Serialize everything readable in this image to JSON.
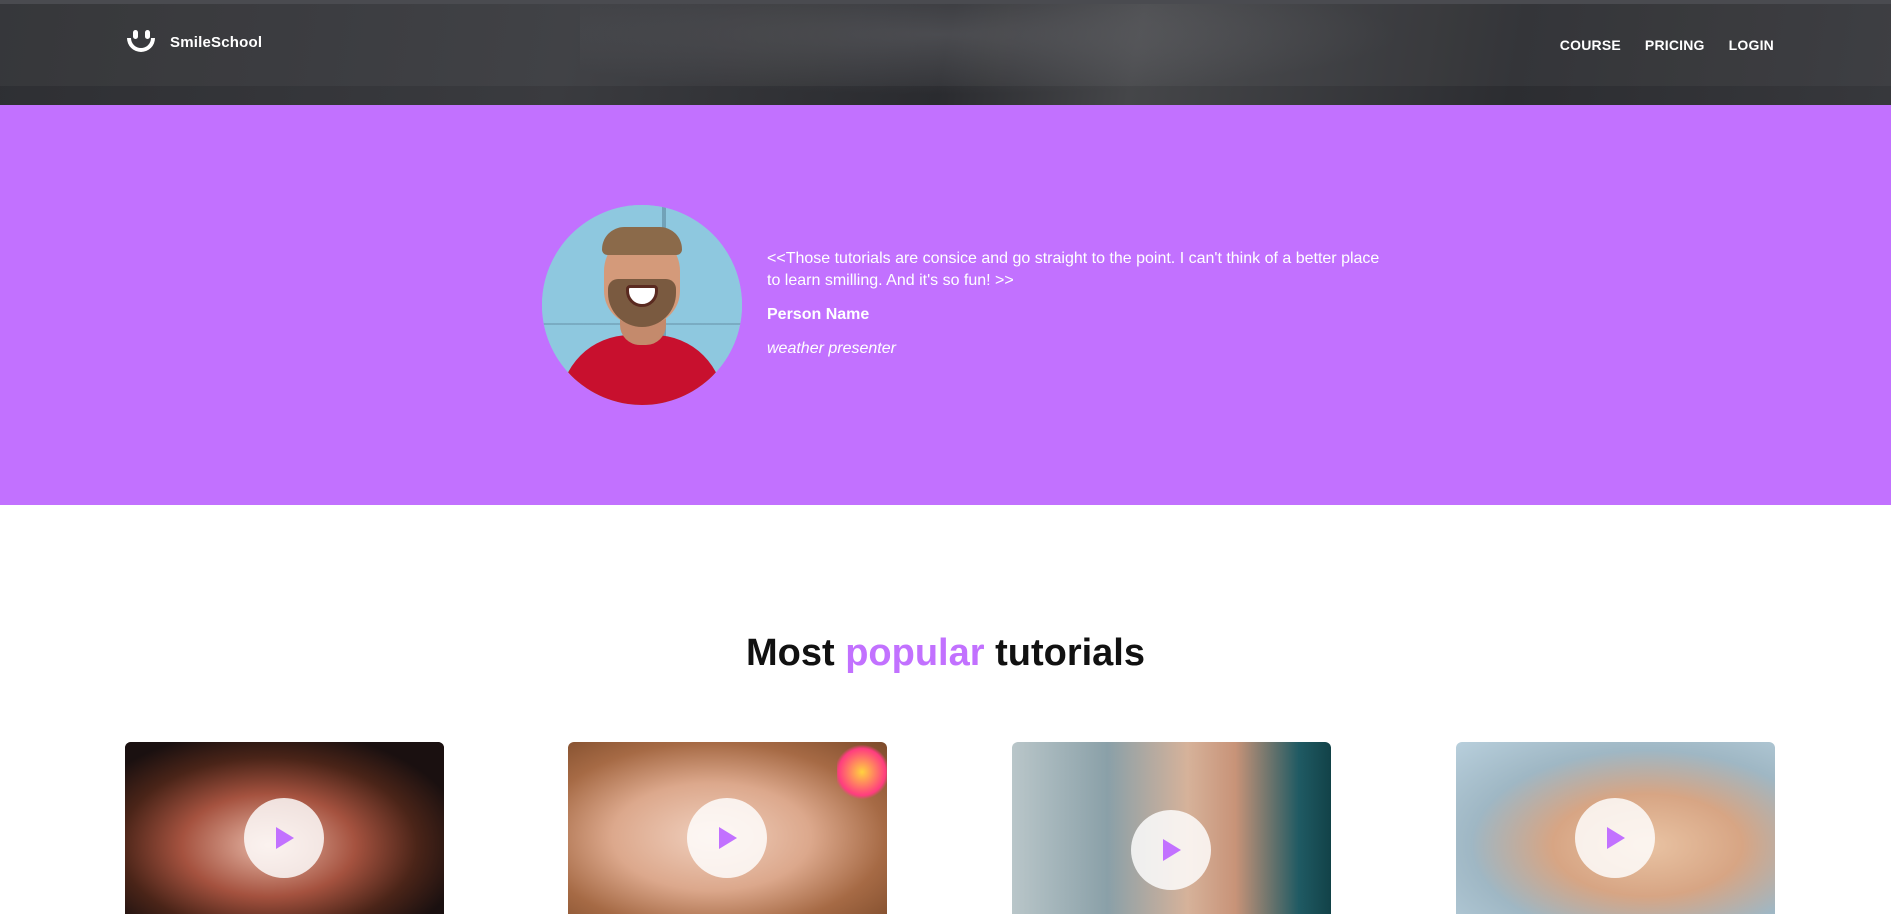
{
  "header": {
    "brand": "SmileSchool",
    "logo_icon": "smile-logo-icon",
    "nav": [
      {
        "label": "COURSE"
      },
      {
        "label": "PRICING"
      },
      {
        "label": "LOGIN"
      }
    ]
  },
  "quote": {
    "text": "<<Those tutorials are consice and go straight to the point. I can't think of a better place to learn smilling. And it's so fun! >>",
    "name": "Person Name",
    "role": "weather presenter"
  },
  "tutorials": {
    "title_prefix": "Most",
    "title_accent": "popular",
    "title_suffix": "tutorials",
    "cards": [
      {
        "play_icon": "play-icon"
      },
      {
        "play_icon": "play-icon"
      },
      {
        "play_icon": "play-icon"
      },
      {
        "play_icon": "play-icon"
      }
    ]
  },
  "colors": {
    "accent": "#c271ff",
    "header_bg": "#333438",
    "text_dark": "#111111"
  }
}
